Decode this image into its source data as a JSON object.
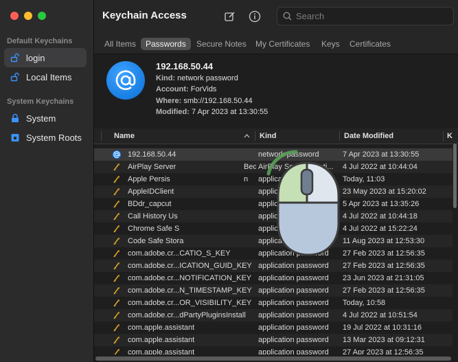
{
  "sidebar": {
    "section_default": "Default Keychains",
    "section_system": "System Keychains",
    "items": [
      {
        "label": "login",
        "icon": "unlocked-padlock-icon",
        "selected": true
      },
      {
        "label": "Local Items",
        "icon": "unlocked-padlock-icon",
        "selected": false
      },
      {
        "label": "System",
        "icon": "locked-padlock-icon",
        "selected": false
      },
      {
        "label": "System Roots",
        "icon": "locked-cabinet-icon",
        "selected": false
      }
    ]
  },
  "toolbar": {
    "title": "Keychain Access",
    "compose_icon": "compose-icon",
    "info_icon": "info-icon",
    "search_placeholder": "Search"
  },
  "tabs": [
    {
      "label": "All Items",
      "active": false
    },
    {
      "label": "Passwords",
      "active": true
    },
    {
      "label": "Secure Notes",
      "active": false
    },
    {
      "label": "My Certificates",
      "active": false
    },
    {
      "label": "Keys",
      "active": false
    },
    {
      "label": "Certificates",
      "active": false
    }
  ],
  "detail": {
    "title": "192.168.50.44",
    "kind_label": "Kind:",
    "kind_value": "network password",
    "account_label": "Account:",
    "account_value": "ForVids",
    "where_label": "Where:",
    "where_value": "smb://192.168.50.44",
    "modified_label": "Modified:",
    "modified_value": "7 Apr 2023 at 13:30:55"
  },
  "columns": {
    "name": "Name",
    "kind": "Kind",
    "date_modified": "Date Modified",
    "extra": "K"
  },
  "rows": [
    {
      "name": "192.168.50.44",
      "kind": "network password",
      "date": "7 Apr 2023 at 13:30:55",
      "icon": "network-at-icon"
    },
    {
      "name": "AirPlay Server",
      "name_tail": "Bedc",
      "kind": "AirPlay Server Identi...",
      "date": "4 Jul 2022 at 10:44:04",
      "icon": "key-icon"
    },
    {
      "name": "Apple Persis",
      "name_tail": "n",
      "kind": "application password",
      "date": "Today, 11:03",
      "icon": "key-icon"
    },
    {
      "name": "AppleIDClient",
      "kind": "application password",
      "date": "23 May 2023 at 15:20:02",
      "icon": "key-icon"
    },
    {
      "name": "BDdr_capcut",
      "kind": "application password",
      "date": "5 Apr 2023 at 13:35:26",
      "icon": "key-icon"
    },
    {
      "name": "Call History Us",
      "kind": "application password",
      "date": "4 Jul 2022 at 10:44:18",
      "icon": "key-icon"
    },
    {
      "name": "Chrome Safe S",
      "kind": "application password",
      "date": "4 Jul 2022 at 15:22:24",
      "icon": "key-icon"
    },
    {
      "name": "Code Safe Stora",
      "kind": "application password",
      "date": "11 Aug 2023 at 12:53:30",
      "icon": "key-icon"
    },
    {
      "name": "com.adobe.cr...CATIO_S_KEY",
      "kind": "application password",
      "date": "27 Feb 2023 at 12:56:35",
      "icon": "key-icon"
    },
    {
      "name": "com.adobe.cr...ICATION_GUID_KEY",
      "kind": "application password",
      "date": "27 Feb 2023 at 12:56:35",
      "icon": "key-icon"
    },
    {
      "name": "com.adobe.cr...NOTIFICATION_KEY",
      "kind": "application password",
      "date": "23 Jun 2023 at 21:31:05",
      "icon": "key-icon"
    },
    {
      "name": "com.adobe.cr...N_TIMESTAMP_KEY",
      "kind": "application password",
      "date": "27 Feb 2023 at 12:56:35",
      "icon": "key-icon"
    },
    {
      "name": "com.adobe.cr...OR_VISIBILITY_KEY",
      "kind": "application password",
      "date": "Today, 10:58",
      "icon": "key-icon"
    },
    {
      "name": "com.adobe.cr...dPartyPluginsInstall",
      "kind": "application password",
      "date": "4 Jul 2022 at 10:51:54",
      "icon": "key-icon"
    },
    {
      "name": "com.apple.assistant",
      "kind": "application password",
      "date": "19 Jul 2022 at 10:31:16",
      "icon": "key-icon"
    },
    {
      "name": "com.apple.assistant",
      "kind": "application password",
      "date": "13 Mar 2023 at 09:12:31",
      "icon": "key-icon"
    },
    {
      "name": "com.apple.assistant",
      "kind": "application password",
      "date": "27 Apr 2023 at 12:56:35",
      "icon": "key-icon"
    }
  ],
  "overlay": {
    "icon": "mouse-left-click-icon",
    "colors": {
      "body": "#b8c8dc",
      "left_button": "#c5e0b4",
      "outline": "#3c3c3c",
      "arc": "#5aa05a"
    }
  },
  "colors": {
    "accent": "#0a84ff",
    "selected_tab": "#505050",
    "background": "#1e1e1e"
  }
}
